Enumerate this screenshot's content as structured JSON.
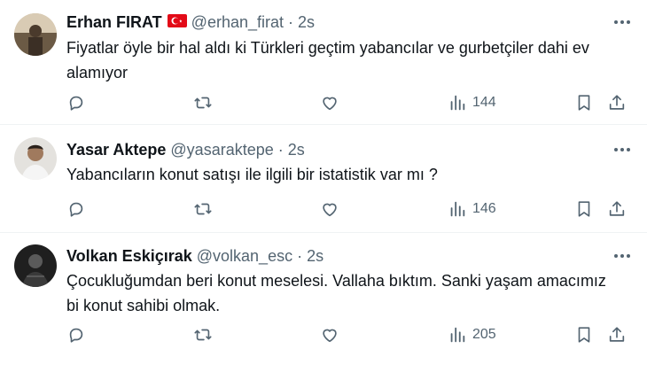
{
  "tweets": [
    {
      "name": "Erhan FIRAT",
      "handle": "@erhan_firat",
      "sep": "·",
      "time": "2s",
      "line1": "Fiyatlar öyle bir hal aldı ki Türkleri geçtim yabancılar ve gurbetçiler dahi ev",
      "line2": "alamıyor",
      "views": "144",
      "has_flag": true
    },
    {
      "name": "Yasar Aktepe",
      "handle": "@yasaraktepe",
      "sep": "·",
      "time": "2s",
      "line1": "Yabancıların konut satışı ile ilgili bir istatistik var mı ?",
      "line2": "",
      "views": "146",
      "has_flag": false
    },
    {
      "name": "Volkan Eskiçırak",
      "handle": "@volkan_esc",
      "sep": "·",
      "time": "2s",
      "line1": "Çocukluğumdan beri konut meselesi. Vallaha bıktım. Sanki yaşam amacımız",
      "line2": "bi konut sahibi olmak.",
      "views": "205",
      "has_flag": false
    }
  ],
  "icons": {
    "reply": "reply-icon",
    "retweet": "retweet-icon",
    "like": "heart-icon",
    "views": "views-icon",
    "bookmark": "bookmark-icon",
    "share": "share-icon",
    "more": "more-icon"
  },
  "colors": {
    "text": "#0f1419",
    "muted": "#536471",
    "divider": "#eff3f4"
  }
}
